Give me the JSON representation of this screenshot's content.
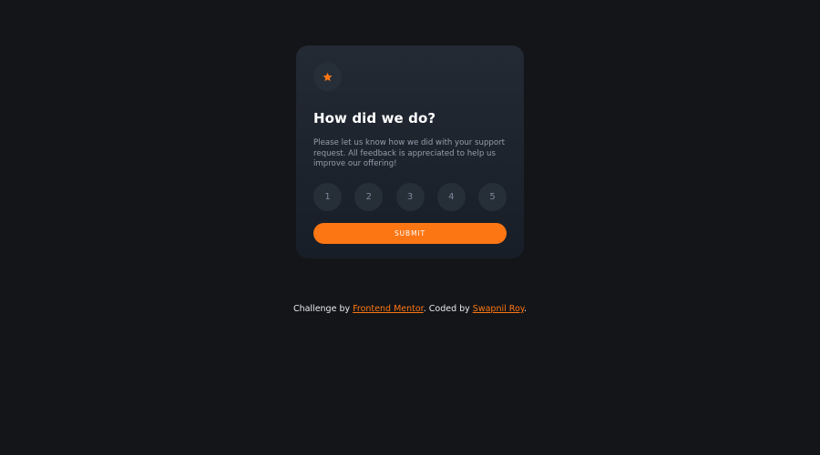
{
  "colors": {
    "background": "#131518",
    "card": "#232a34",
    "accent": "#fc7614",
    "rating_bg": "#262f38"
  },
  "card": {
    "icon": "star-icon",
    "title": "How did we do?",
    "description": "Please let us know how we did with your support request. All feedback is appreciated to help us improve our offering!",
    "ratings": [
      "1",
      "2",
      "3",
      "4",
      "5"
    ],
    "submit_label": "SUBMIT"
  },
  "footer": {
    "prefix": "Challenge by ",
    "link1": "Frontend Mentor",
    "middle": ". Coded by ",
    "link2": "Swapnil Roy",
    "suffix": "."
  }
}
